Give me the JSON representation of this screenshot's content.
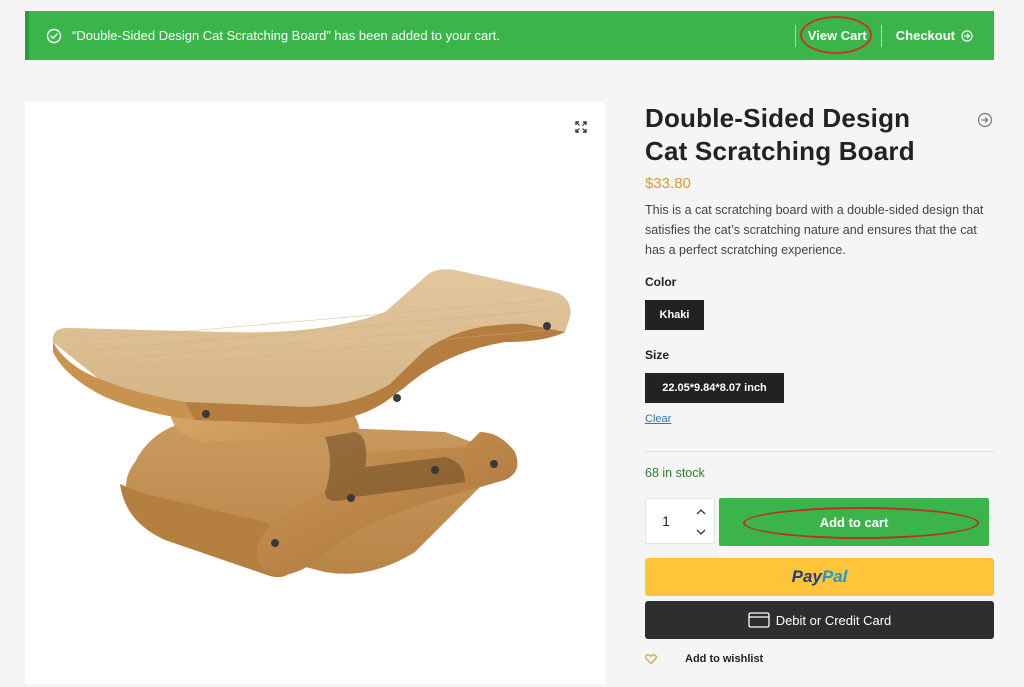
{
  "notice": {
    "message": "“Double-Sided Design Cat Scratching Board” has been added to your cart.",
    "view_cart_label": "View Cart",
    "checkout_label": "Checkout"
  },
  "product": {
    "title": "Double-Sided Design Cat Scratching Board",
    "price": "$33.80",
    "description": "This is a cat scratching board with a double-sided design that satisfies the cat’s scratching nature and ensures that the cat has a perfect scratching experience.",
    "stock": "68 in stock"
  },
  "attributes": {
    "color_label": "Color",
    "color_value": "Khaki",
    "size_label": "Size",
    "size_value": "22.05*9.84*8.07 inch",
    "clear_label": "Clear"
  },
  "cart": {
    "quantity": "1",
    "add_to_cart_label": "Add to cart"
  },
  "payment": {
    "paypal_pay": "Pay",
    "paypal_pal": "Pal",
    "card_label": "Debit or Credit Card"
  },
  "wishlist": {
    "label": "Add to wishlist"
  },
  "colors": {
    "notice_green": "#3bb54a",
    "accent_green": "#3bb54a",
    "price_gold": "#d59b36",
    "paypal_yellow": "#ffc439",
    "dark": "#2c2e2f",
    "annotation_red": "#c0392b"
  },
  "icons": [
    "check-circle-icon",
    "arrow-right-circle-icon",
    "expand-icon",
    "share-icon",
    "chevron-up-icon",
    "chevron-down-icon",
    "credit-card-icon",
    "heart-icon"
  ]
}
